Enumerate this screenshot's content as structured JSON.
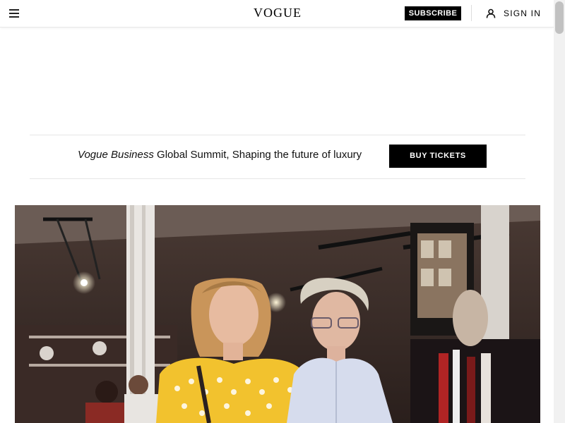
{
  "header": {
    "logo": "VOGUE",
    "subscribe_label": "SUBSCRIBE",
    "signin_label": "SIGN IN",
    "menu_icon": "hamburger-menu-icon",
    "user_icon": "user-icon"
  },
  "ad": {
    "line1": "",
    "line2": ""
  },
  "promo": {
    "brand": "Vogue Business",
    "text": " Global Summit, Shaping the future of luxury",
    "cta_label": "BUY TICKETS"
  },
  "hero": {
    "description": "photo-two-women-at-event"
  },
  "colors": {
    "black": "#000000",
    "white": "#ffffff",
    "divider": "#e6e6e6"
  }
}
